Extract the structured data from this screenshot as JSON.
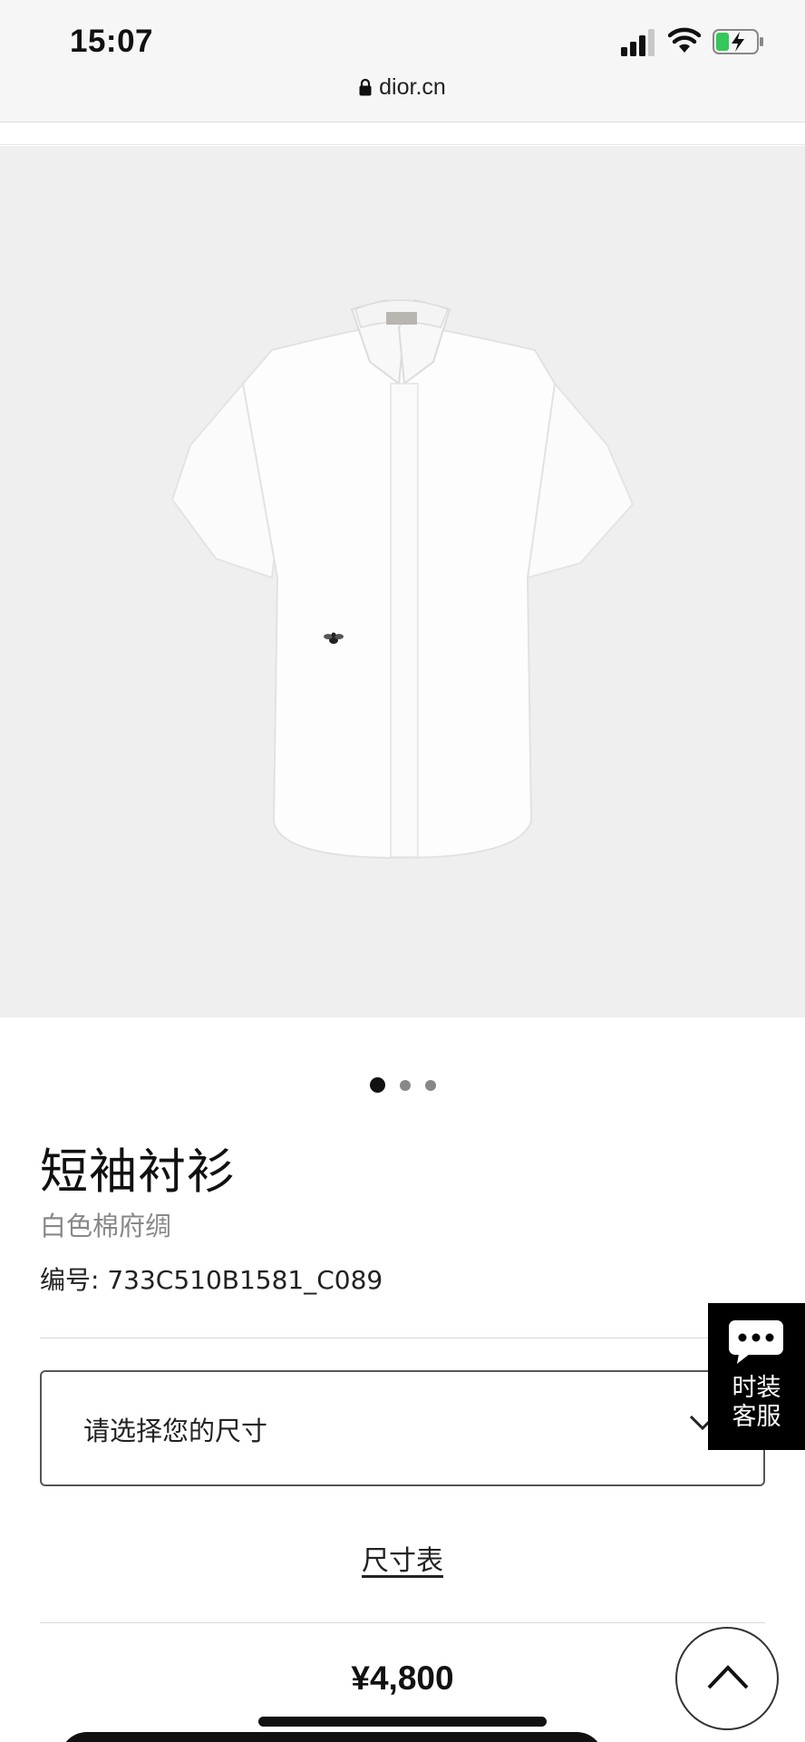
{
  "status_bar": {
    "time": "15:07",
    "icons": [
      "signal-icon",
      "wifi-icon",
      "battery-charging-icon"
    ],
    "battery_color": "#34c759"
  },
  "browser": {
    "url": "dior.cn",
    "lock_icon": "lock-icon"
  },
  "carousel": {
    "image_subject": "short-sleeve-white-shirt",
    "image_background": "#efefef",
    "slide_count": 3,
    "active_index": 0
  },
  "product": {
    "title": "短袖衬衫",
    "subtitle": "白色棉府绸",
    "reference": "编号: 733C510B1581_C089"
  },
  "size_select": {
    "placeholder": "请选择您的尺寸",
    "icon": "chevron-down-icon"
  },
  "size_chart": {
    "label": "尺寸表"
  },
  "price": {
    "value": "¥4,800"
  },
  "chat_widget": {
    "icon": "chat-bubble-icon",
    "label_line1": "时装",
    "label_line2": "客服"
  },
  "scroll_top": {
    "icon": "chevron-up-icon"
  }
}
